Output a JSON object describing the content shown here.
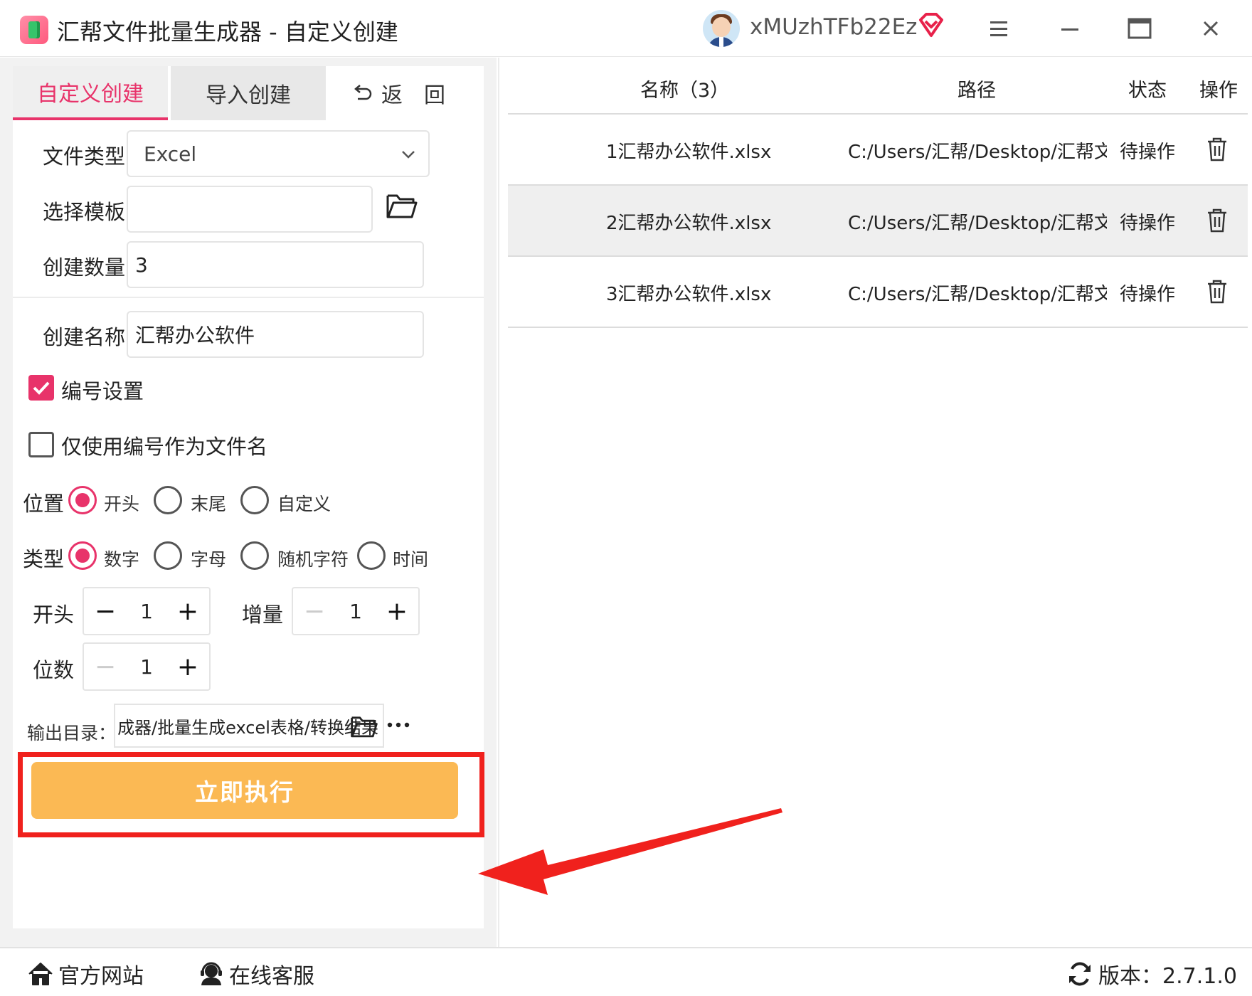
{
  "window": {
    "title": "汇帮文件批量生成器 - 自定义创建",
    "username": "xMUzhTFb22Ez"
  },
  "tabs": {
    "custom": "自定义创建",
    "import": "导入创建",
    "back": "返　回"
  },
  "form": {
    "file_type_label": "文件类型",
    "file_type_value": "Excel",
    "template_label": "选择模板",
    "template_value": "",
    "count_label": "创建数量",
    "count_value": "3",
    "name_label": "创建名称",
    "name_value": "汇帮办公软件"
  },
  "numbering": {
    "enable_label": "编号设置",
    "enable_checked": true,
    "only_number_label": "仅使用编号作为文件名",
    "only_number_checked": false,
    "position_label": "位置",
    "position_options": [
      "开头",
      "末尾",
      "自定义"
    ],
    "position_selected": "开头",
    "type_label": "类型",
    "type_options": [
      "数字",
      "字母",
      "随机字符",
      "时间"
    ],
    "type_selected": "数字",
    "start_label": "开头",
    "start_value": "1",
    "increment_label": "增量",
    "increment_value": "1",
    "digits_label": "位数",
    "digits_value": "1"
  },
  "output": {
    "label": "输出目录：",
    "path": "成器/批量生成excel表格/转换结果"
  },
  "execute_label": "立即执行",
  "table": {
    "columns": [
      "名称（3）",
      "路径",
      "状态",
      "操作"
    ],
    "rows": [
      {
        "name": "1汇帮办公软件.xlsx",
        "path": "C:/Users/汇帮/Desktop/汇帮文件",
        "status": "待操作"
      },
      {
        "name": "2汇帮办公软件.xlsx",
        "path": "C:/Users/汇帮/Desktop/汇帮文件",
        "status": "待操作"
      },
      {
        "name": "3汇帮办公软件.xlsx",
        "path": "C:/Users/汇帮/Desktop/汇帮文件",
        "status": "待操作"
      }
    ]
  },
  "footer": {
    "website": "官方网站",
    "support": "在线客服",
    "version": "版本：2.7.1.0"
  },
  "colors": {
    "accent": "#e8336a",
    "execute": "#fbb954",
    "highlight": "#f0211d"
  }
}
